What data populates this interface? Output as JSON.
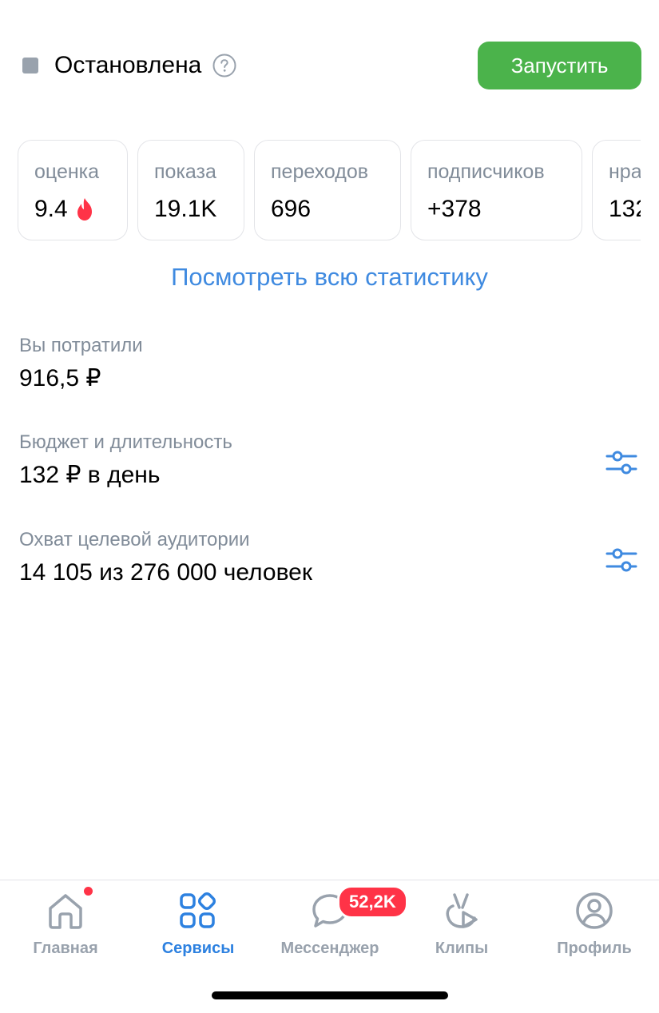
{
  "status": {
    "text": "Остановлена",
    "help_icon": "question-circle-icon",
    "launch_label": "Запустить",
    "launch_color": "#4bb34b"
  },
  "stats": [
    {
      "label": "оценка",
      "value": "9.4",
      "icon": "fire-icon"
    },
    {
      "label": "показа",
      "value": "19.1K"
    },
    {
      "label": "переходов",
      "value": "696"
    },
    {
      "label": "подписчиков",
      "value": "+378"
    },
    {
      "label": "нра",
      "value": "132"
    }
  ],
  "all_stats_link": "Посмотреть всю статистику",
  "spent": {
    "label": "Вы потратили",
    "value": "916,5 ₽"
  },
  "budget": {
    "label": "Бюджет и длительность",
    "value": "132 ₽ в день",
    "icon": "sliders-icon"
  },
  "reach": {
    "label": "Охват целевой аудитории",
    "value": "14 105 из 276 000 человек",
    "icon": "sliders-icon"
  },
  "tabs": [
    {
      "label": "Главная",
      "icon": "home-icon",
      "has_dot": true
    },
    {
      "label": "Сервисы",
      "icon": "services-icon",
      "active": true
    },
    {
      "label": "Мессенджер",
      "icon": "messenger-icon",
      "badge": "52,2K"
    },
    {
      "label": "Клипы",
      "icon": "clips-icon"
    },
    {
      "label": "Профиль",
      "icon": "profile-icon"
    }
  ],
  "colors": {
    "accent": "#2d81e0",
    "link": "#3f8ae0",
    "secondary_text": "#818c99",
    "badge": "#ff3347"
  }
}
